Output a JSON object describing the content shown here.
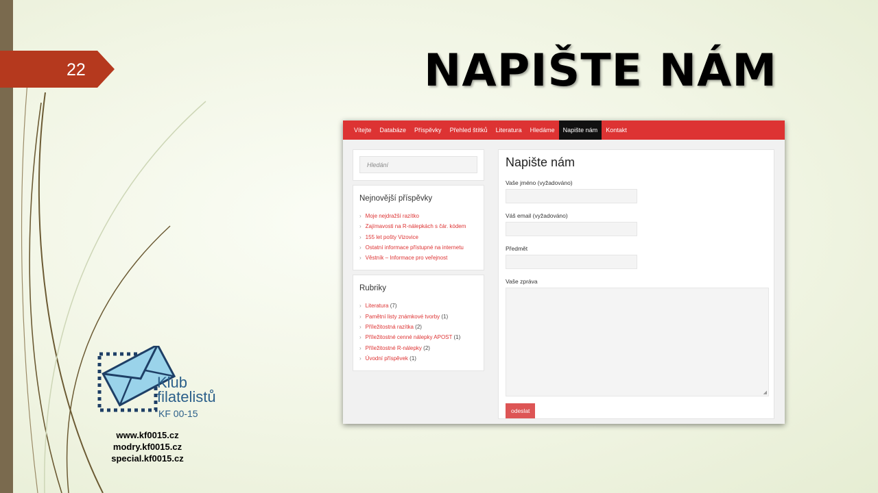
{
  "slide": {
    "number": "22",
    "title": "NAPIŠTE NÁM"
  },
  "logo": {
    "line1": "Klub",
    "line2": "filatelistů",
    "line3": "KF 00-15"
  },
  "links": [
    "www.kf0015.cz",
    "modry.kf0015.cz",
    "special.kf0015.cz"
  ],
  "nav": {
    "items": [
      "Vítejte",
      "Databáze",
      "Příspěvky",
      "Přehled štítků",
      "Literatura",
      "Hledáme",
      "Napište nám",
      "Kontakt"
    ],
    "active_index": 6
  },
  "sidebar": {
    "search_placeholder": "Hledání",
    "recent": {
      "title": "Nejnovější příspěvky",
      "items": [
        "Moje nejdražší razítko",
        "Zajímavosti na R-nálepkách s čár. kódem",
        "155 let pošty Vizovice",
        "Ostatní informace přístupné na internetu",
        "Věstník – Informace pro veřejnost"
      ]
    },
    "categories": {
      "title": "Rubriky",
      "items": [
        {
          "label": "Literatura",
          "count": "(7)"
        },
        {
          "label": "Pamětní listy známkové tvorby",
          "count": "(1)"
        },
        {
          "label": "Příležitostná razítka",
          "count": "(2)"
        },
        {
          "label": "Příležitostné cenné nálepky APOST",
          "count": "(1)"
        },
        {
          "label": "Příležitostné R-nálepky",
          "count": "(2)"
        },
        {
          "label": "Úvodní příspěvek",
          "count": "(1)"
        }
      ]
    }
  },
  "form": {
    "title": "Napište nám",
    "name_label": "Vaše jméno (vyžadováno)",
    "email_label": "Váš email (vyžadováno)",
    "subject_label": "Předmět",
    "message_label": "Vaše zpráva",
    "submit_label": "odeslat"
  },
  "colors": {
    "accent_red": "#dd3333",
    "tag_red": "#b5391e",
    "logo_blue": "#2b5f8a"
  }
}
